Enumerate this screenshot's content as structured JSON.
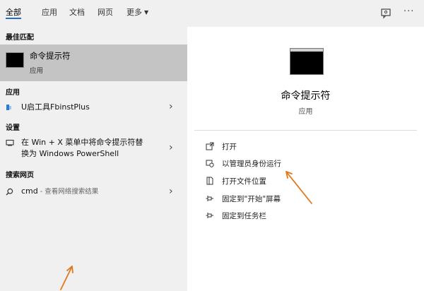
{
  "tabs": [
    {
      "label": "全部"
    },
    {
      "label": "应用"
    },
    {
      "label": "文档"
    },
    {
      "label": "网页"
    },
    {
      "label": "更多"
    }
  ],
  "left": {
    "best_match_header": "最佳匹配",
    "best_match": {
      "title": "命令提示符",
      "subtitle": "应用"
    },
    "apps_header": "应用",
    "app_item": "U启工具FbinstPlus",
    "settings_header": "设置",
    "setting_item_line1": "在 Win + X 菜单中将命令提示符替",
    "setting_item_line2": "换为 Windows PowerShell",
    "web_header": "搜索网页",
    "web_item_query": "cmd",
    "web_item_hint": " - 查看网络搜索结果"
  },
  "right": {
    "title": "命令提示符",
    "subtitle": "应用",
    "actions": [
      {
        "label": "打开",
        "icon": "open-icon"
      },
      {
        "label": "以管理员身份运行",
        "icon": "shield-run-icon"
      },
      {
        "label": "打开文件位置",
        "icon": "file-location-icon"
      },
      {
        "label": "固定到\"开始\"屏幕",
        "icon": "pin-icon"
      },
      {
        "label": "固定到任务栏",
        "icon": "pin-icon"
      }
    ]
  },
  "colors": {
    "accent": "#1f6fd1",
    "selection": "#c4c4c4",
    "annotation_arrow": "#e2781e"
  }
}
